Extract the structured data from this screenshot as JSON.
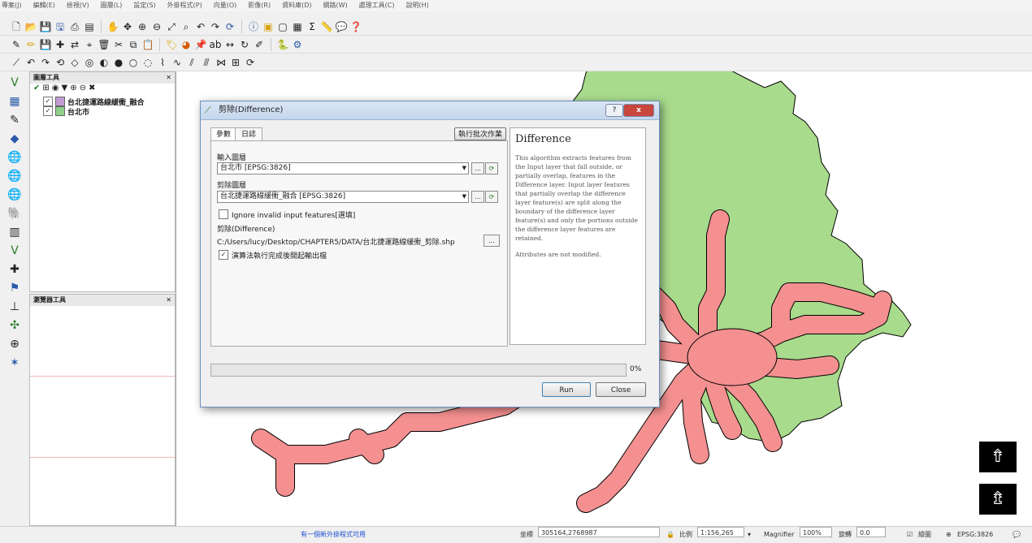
{
  "menubar": [
    "專案(J)",
    "編輯(E)",
    "檢視(V)",
    "圖層(L)",
    "設定(S)",
    "外掛程式(P)",
    "向量(O)",
    "影像(R)",
    "資料庫(D)",
    "網路(W)",
    "處理工具(C)",
    "說明(H)"
  ],
  "layers_panel": {
    "title": "圖層工具",
    "layers": [
      {
        "name": "台北捷運路線緩衝_融合",
        "checked": true,
        "color": "#c39bd3"
      },
      {
        "name": "台北市",
        "checked": true,
        "color": "#8fd18a"
      }
    ]
  },
  "browser_panel": {
    "title": "瀏覽器工具"
  },
  "dialog": {
    "title": "剪除(Difference)",
    "help_button": "?",
    "close_button": "x",
    "tabs": [
      "參數",
      "日誌"
    ],
    "batch_button": "執行批次作業",
    "input_label": "輸入圖層",
    "input_value": "台北市 [EPSG:3826]",
    "diff_label": "剪除圖層",
    "diff_value": "台北捷運路線緩衝_融合 [EPSG:3826]",
    "ignore_label": "Ignore invalid input features[選填]",
    "output_label": "剪除(Difference)",
    "output_value": "C:/Users/lucy/Desktop/CHAPTER5/DATA/台北捷運路線緩衝_剪除.shp",
    "browse_label": "...",
    "open_after_label": "演算法執行完成後開起輸出檔",
    "progress_value": 0,
    "progress_text": "0%",
    "run_button": "Run",
    "close_label": "Close",
    "help": {
      "heading": "Difference",
      "body": "This algorithm extracts features from the Input layer that fall outside, or partially overlap, features in the Difference layer. Input layer features that partially overlap the difference layer feature(s) are split along the boundary of the difference layer feature(s) and only the portions outside the difference layer features are retained.",
      "note": "Attributes are not modified."
    }
  },
  "status": {
    "message": "有一個新外掛程式可用",
    "coord_label": "坐標",
    "coord_value": "305164,2768987",
    "scale_label": "比例",
    "scale_value": "1:156,265",
    "magnifier_label": "Magnifier",
    "magnifier_value": "100%",
    "rotation_label": "旋轉",
    "rotation_value": "0.0",
    "render_label": "繪圖",
    "crs": "EPSG:3826"
  },
  "colors": {
    "polygon_fill": "#a8db8c",
    "buffer_fill": "#f49090",
    "outline": "#000000"
  },
  "icons": {
    "float_top": "north-arrow-icon",
    "float_bottom": "scale-arrow-icon"
  }
}
